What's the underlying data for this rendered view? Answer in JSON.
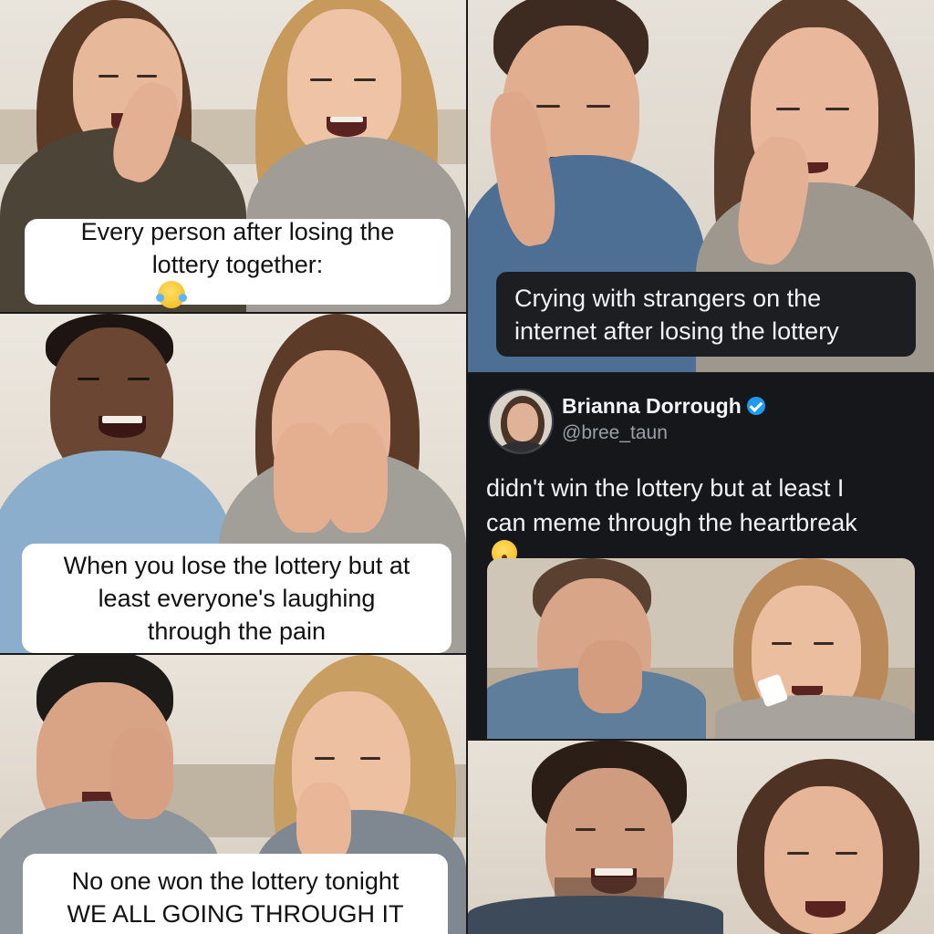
{
  "meme_top_left": {
    "caption_line1": "Every person after losing the",
    "caption_line2": "lottery together:",
    "emoji": "laughing-tears-emoji"
  },
  "meme_top_right": {
    "caption_line1": "Crying with strangers on the",
    "caption_line2": "internet after losing the lottery"
  },
  "meme_middle_left": {
    "caption_line1": "When you lose the lottery but at",
    "caption_line2": "least everyone's laughing",
    "caption_line3": "through the pain"
  },
  "meme_bottom_left": {
    "caption_line1": "No one won the lottery tonight",
    "caption_line2": "WE ALL GOING THROUGH IT"
  },
  "tweet": {
    "display_name": "Brianna Dorrough",
    "handle": "@bree_taun",
    "text_line1": "didn't win the lottery but at least I",
    "text_line2": "can meme through the heartbreak",
    "emoji": "worried-face-emoji",
    "verified_badge_color": "#1d9bf0"
  },
  "colors": {
    "caption_bg": "#ffffff",
    "dark_caption_bg": "#1c1e22",
    "tweet_bg": "#15171b"
  }
}
